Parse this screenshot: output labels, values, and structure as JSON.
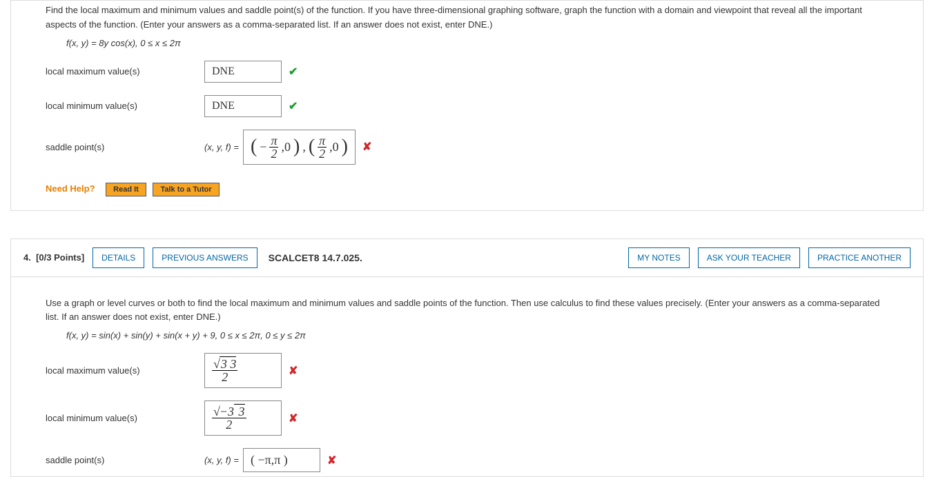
{
  "q3": {
    "prompt": "Find the local maximum and minimum values and saddle point(s) of the function. If you have three-dimensional graphing software, graph the function with a domain and viewpoint that reveal all the important aspects of the function. (Enter your answers as a comma-separated list. If an answer does not exist, enter DNE.)",
    "function": "f(x, y) = 8y cos(x),    0 ≤ x ≤ 2π",
    "rows": {
      "max": {
        "label": "local maximum value(s)",
        "value": "DNE",
        "mark": "✔"
      },
      "min": {
        "label": "local minimum value(s)",
        "value": "DNE",
        "mark": "✔"
      },
      "saddle": {
        "label": "saddle point(s)",
        "prefix": "(x, y, f)  =",
        "mark": "✘"
      }
    },
    "help": {
      "title": "Need Help?",
      "read": "Read It",
      "tutor": "Talk to a Tutor"
    }
  },
  "q4": {
    "header": {
      "num": "4.",
      "points": "[0/3 Points]",
      "details": "DETAILS",
      "prev": "PREVIOUS ANSWERS",
      "assign": "SCALCET8 14.7.025.",
      "notes": "MY NOTES",
      "ask": "ASK YOUR TEACHER",
      "practice": "PRACTICE ANOTHER"
    },
    "prompt": "Use a graph or level curves or both to find the local maximum and minimum values and saddle points of the function. Then use calculus to find these values precisely. (Enter your answers as a comma-separated list. If an answer does not exist, enter DNE.)",
    "function": "f(x, y) = sin(x) + sin(y) + sin(x + y) + 9,    0 ≤ x ≤ 2π,    0 ≤ y ≤ 2π",
    "rows": {
      "max": {
        "label": "local maximum value(s)",
        "mark": "✘"
      },
      "min": {
        "label": "local minimum value(s)",
        "mark": "✘"
      },
      "saddle": {
        "label": "saddle point(s)",
        "prefix": "(x, y, f)  =",
        "value": "( −π,π )",
        "mark": "✘"
      }
    }
  },
  "chart_data": {
    "type": "table",
    "title": "Homework answer entry — SCALCET8 14.7.025 and preceding problem",
    "rows": [
      {
        "problem": "f(x,y)=8y cos(x)",
        "field": "local maximum value(s)",
        "answer": "DNE",
        "graded": "correct"
      },
      {
        "problem": "f(x,y)=8y cos(x)",
        "field": "local minimum value(s)",
        "answer": "DNE",
        "graded": "correct"
      },
      {
        "problem": "f(x,y)=8y cos(x)",
        "field": "saddle point(s) (x,y,f)",
        "answer": "(-π/2,0),(π/2,0)",
        "graded": "incorrect"
      },
      {
        "problem": "f(x,y)=sin(x)+sin(y)+sin(x+y)+9",
        "field": "local maximum value(s)",
        "answer": "3√3/2",
        "graded": "incorrect"
      },
      {
        "problem": "f(x,y)=sin(x)+sin(y)+sin(x+y)+9",
        "field": "local minimum value(s)",
        "answer": "-3√3/2",
        "graded": "incorrect"
      },
      {
        "problem": "f(x,y)=sin(x)+sin(y)+sin(x+y)+9",
        "field": "saddle point(s) (x,y,f)",
        "answer": "(-π,π)",
        "graded": "incorrect"
      }
    ]
  }
}
